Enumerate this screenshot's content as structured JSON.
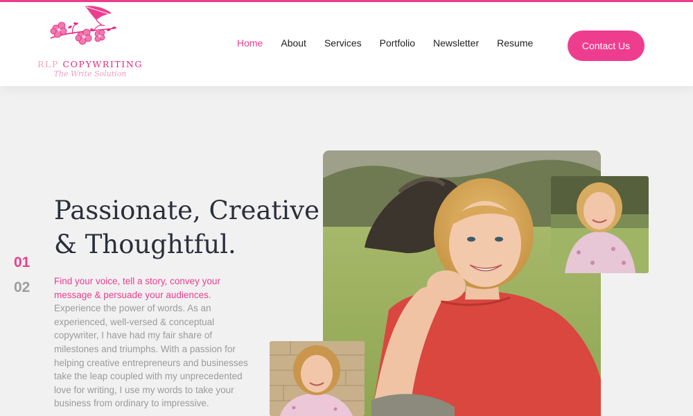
{
  "brand": {
    "name_part1": "RLP ",
    "name_part2": "COPYWRITING",
    "tagline": "The Write Solution"
  },
  "nav": {
    "items": [
      {
        "label": "Home",
        "active": true
      },
      {
        "label": "About",
        "active": false
      },
      {
        "label": "Services",
        "active": false
      },
      {
        "label": "Portfolio",
        "active": false
      },
      {
        "label": "Newsletter",
        "active": false
      },
      {
        "label": "Resume",
        "active": false
      }
    ],
    "cta_label": "Contact Us"
  },
  "slider": {
    "numbers": [
      "01",
      "02"
    ],
    "active_index": 0
  },
  "hero": {
    "headline_line1": "Passionate, Creative",
    "headline_line2": "& Thoughtful.",
    "highlight": "Find your voice, tell a story, convey your message & persuade your audiences.",
    "body": "Experience the power of words. As an experienced, well-versed & conceptual copywriter, I have had my fair share of milestones and triumphs. With a passion for helping creative entrepreneurs and businesses take the leap coupled with my unprecedented love for writing, I use my words to take your business from ordinary to impressive."
  },
  "photos": [
    {
      "name": "main-portrait-photo"
    },
    {
      "name": "top-right-portrait-photo"
    },
    {
      "name": "bottom-left-portrait-photo"
    }
  ],
  "colors": {
    "accent": "#ee3d8f",
    "heading": "#2b2f3a",
    "body_text": "#9b9b9b",
    "page_bg": "#f1f1f2",
    "header_bg": "#ffffff"
  }
}
